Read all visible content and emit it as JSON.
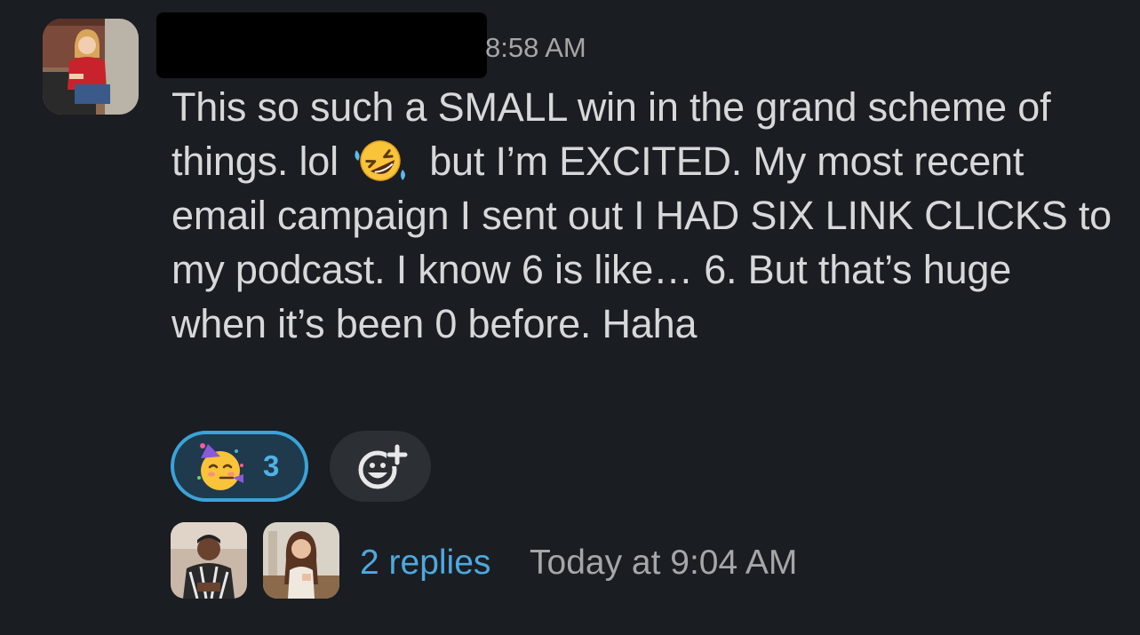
{
  "message": {
    "timestamp": "8:58 AM",
    "text_before_emoji": "This so such a SMALL win in the grand scheme of things. lol",
    "inline_emoji": "rolling-on-floor-laughing-emoji",
    "text_after_emoji": "but I’m EXCITED. My most recent email campaign I sent out I HAD SIX LINK CLICKS to my podcast. I know 6 is like… 6. But that’s huge when it’s been 0 before. Haha"
  },
  "reactions": [
    {
      "emoji": "partying-face-emoji",
      "count": "3",
      "selected": true
    }
  ],
  "add_reaction": {
    "icon": "add-reaction-icon"
  },
  "thread": {
    "reply_count_label": "2 replies",
    "last_reply_label": "Today at 9:04 AM"
  },
  "colors": {
    "background": "#1a1d21",
    "text": "#d7d8d9",
    "muted": "#a4a6a8",
    "link": "#4fa8df",
    "reaction_border": "#3aa3d9",
    "reaction_bg": "#1f3a4d"
  }
}
